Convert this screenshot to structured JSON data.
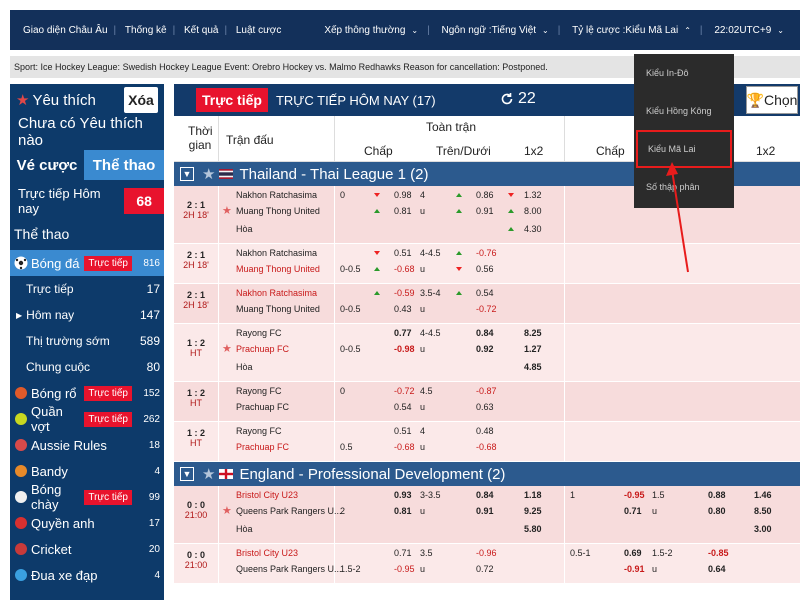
{
  "topbar": {
    "left": [
      "Giao diện Châu Âu",
      "Thống kê",
      "Kết quả",
      "Luật cược"
    ],
    "right": [
      "Xếp thông thường",
      "Ngôn ngữ :Tiếng Việt",
      "Tỷ lệ cược :Kiểu Mã Lai",
      "22:02UTC+9"
    ]
  },
  "notice": "Sport: Ice Hockey League: Swedish Hockey League Event: Orebro Hockey vs. Malmo Redhawks Reason for cancellation: Postponed.",
  "sidebar": {
    "favorites_label": "Yêu thích",
    "clear_label": "Xóa",
    "no_favorites": "Chưa có Yêu thích nào",
    "tab_bet": "Vé cược",
    "tab_sport": "Thể thao",
    "live_today_label": "Trực tiếp Hôm nay",
    "live_today_count": "68",
    "sports_heading": "Thể thao",
    "live_badge": "Trực tiếp",
    "football": {
      "name": "Bóng đá",
      "count": "816"
    },
    "football_sub": [
      {
        "name": "Trực tiếp",
        "count": "17"
      },
      {
        "name": "Hôm nay",
        "count": "147"
      },
      {
        "name": "Thị trường sớm",
        "count": "589"
      },
      {
        "name": "Chung cuộc",
        "count": "80"
      }
    ],
    "sports": [
      {
        "name": "Bóng rổ",
        "count": "152",
        "live": true,
        "color": "#e05a2a"
      },
      {
        "name": "Quần vợt",
        "count": "262",
        "live": true,
        "color": "#c8d820"
      },
      {
        "name": "Aussie Rules",
        "count": "18",
        "live": false,
        "color": "#d84a4a"
      },
      {
        "name": "Bandy",
        "count": "4",
        "live": false,
        "color": "#e88a2a"
      },
      {
        "name": "Bóng chày",
        "count": "99",
        "live": true,
        "color": "#f0f0f0"
      },
      {
        "name": "Quyền anh",
        "count": "17",
        "live": false,
        "color": "#d83030"
      },
      {
        "name": "Cricket",
        "count": "20",
        "live": false,
        "color": "#c83a3a"
      },
      {
        "name": "Đua xe đạp",
        "count": "4",
        "live": false,
        "color": "#3aa0e0"
      }
    ]
  },
  "main": {
    "live_tag": "Trực tiếp",
    "title": "TRỰC TIẾP HÔM NAY (17)",
    "refresh_count": "22",
    "chon": "Chọn",
    "headers": {
      "time": "Thời gian",
      "match": "Trận đấu",
      "full": "Toàn trận",
      "hcp": "Chấp",
      "ou": "Trên/Dưới",
      "x12": "1x2",
      "hcp2": "Chấp",
      "x12b": "1x2"
    },
    "leagues": [
      {
        "name": "Thailand - Thai League 1 (2)"
      },
      {
        "name": "England - Professional Development (2)"
      }
    ]
  },
  "rows": [
    {
      "score": "2 : 1",
      "time": "2H 18'",
      "t1": "Nakhon Ratchasima",
      "t2": "Muang Thong United",
      "t3": "Hòa",
      "star": true,
      "hcp": "0",
      "h1": "0.98",
      "h2": "0.81",
      "ou": "4",
      "ou2": "u",
      "o1": "0.86",
      "o2": "0.91",
      "x1": "1.32",
      "x2": "8.00",
      "x3": "4.30"
    },
    {
      "score": "2 : 1",
      "time": "2H 18'",
      "t1": "Nakhon Ratchasima",
      "t2": "Muang Thong United",
      "hcp": "0-0.5",
      "h1": "0.51",
      "h2": "-0.68",
      "ou": "4-4.5",
      "ou2": "u",
      "o1": "-0.76",
      "o2": "0.56"
    },
    {
      "score": "2 : 1",
      "time": "2H 18'",
      "t1": "Nakhon Ratchasima",
      "t2": "Muang Thong United",
      "hcp": "0-0.5",
      "h1": "-0.59",
      "h2": "0.43",
      "ou": "3.5-4",
      "ou2": "u",
      "o1": "0.54",
      "o2": "-0.72"
    },
    {
      "score": "1 : 2",
      "time": "HT",
      "t1": "Rayong FC",
      "t2": "Prachuap FC",
      "t3": "Hòa",
      "star": true,
      "hcp": "0-0.5",
      "h1": "0.77",
      "h2": "-0.98",
      "ou": "4-4.5",
      "ou2": "u",
      "o1": "0.84",
      "o2": "0.92",
      "x1": "8.25",
      "x2": "1.27",
      "x3": "4.85"
    },
    {
      "score": "1 : 2",
      "time": "HT",
      "t1": "Rayong FC",
      "t2": "Prachuap FC",
      "hcp": "0",
      "h1": "-0.72",
      "h2": "0.54",
      "ou": "4.5",
      "ou2": "u",
      "o1": "-0.87",
      "o2": "0.63"
    },
    {
      "score": "1 : 2",
      "time": "HT",
      "t1": "Rayong FC",
      "t2": "Prachuap FC",
      "hcp": "0.5",
      "h1": "0.51",
      "h2": "-0.68",
      "ou": "4",
      "ou2": "u",
      "o1": "0.48",
      "o2": "-0.68"
    },
    {
      "score": "0 : 0",
      "time": "21:00",
      "t1": "Bristol City U23",
      "t2": "Queens Park Rangers U...",
      "t3": "Hòa",
      "star": true,
      "hcp": "2",
      "h1": "0.93",
      "h2": "0.81",
      "ou": "3-3.5",
      "ou2": "u",
      "o1": "0.84",
      "o2": "0.91",
      "x1": "1.18",
      "x2": "9.25",
      "x3": "5.80",
      "hcp2": "1",
      "h21": "-0.95",
      "h22": "0.71",
      "ou21": "1.5",
      "ou22": "u",
      "o21": "0.88",
      "o22": "0.80",
      "x21": "1.46",
      "x22": "8.50",
      "x23": "3.00"
    },
    {
      "score": "0 : 0",
      "time": "21:00",
      "t1": "Bristol City U23",
      "t2": "Queens Park Rangers U...",
      "hcp": "1.5-2",
      "h1": "0.71",
      "h2": "-0.95",
      "ou": "3.5",
      "ou2": "u",
      "o1": "-0.96",
      "o2": "0.72",
      "hcp2": "0.5-1",
      "h21": "0.69",
      "h22": "-0.91",
      "ou21": "1.5-2",
      "ou22": "u",
      "o21": "-0.85",
      "o22": "0.64"
    }
  ],
  "dropdown": {
    "options": [
      "Kiểu In-Đô",
      "Kiểu Hồng Kông",
      "Kiểu Mã Lai",
      "Số thập phân"
    ]
  }
}
